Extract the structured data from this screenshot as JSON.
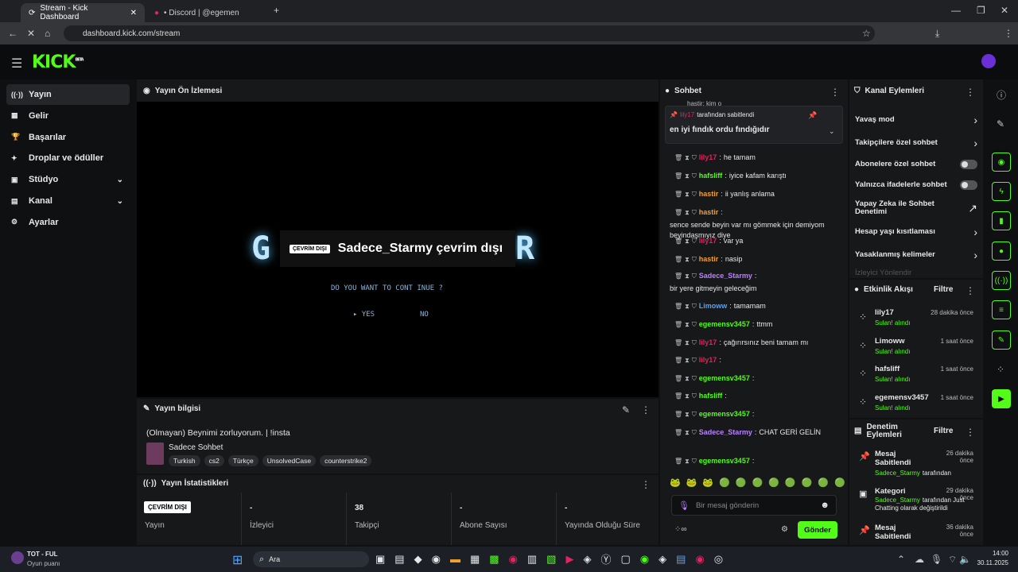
{
  "browser": {
    "tab1": "Stream - Kick Dashboard",
    "tab2": "• Discord | @egemen",
    "url": "dashboard.kick.com/stream"
  },
  "logo": {
    "text": "KICK",
    "beta": "BETA"
  },
  "sidebar": {
    "items": [
      {
        "label": "Yayın",
        "icon": "broadcast-icon"
      },
      {
        "label": "Gelir",
        "icon": "money-icon"
      },
      {
        "label": "Başarılar",
        "icon": "trophy-icon"
      },
      {
        "label": "Droplar ve ödüller",
        "icon": "gift-icon"
      },
      {
        "label": "Stüdyo",
        "icon": "studio-icon"
      },
      {
        "label": "Kanal",
        "icon": "channel-icon"
      },
      {
        "label": "Ayarlar",
        "icon": "gear-icon"
      }
    ]
  },
  "preview": {
    "title": "Yayın Ön İzlemesi",
    "badge": "ÇEVRİM DIŞI",
    "offline": "Sadece_Starmy çevrim dışı",
    "question": "DO YOU WANT TO CONT INUE ?",
    "yes": "▸ YES",
    "no": "NO",
    "left_letter": "G",
    "right_letter": "R"
  },
  "info": {
    "title": "Yayın bilgisi",
    "stream_title": "(Olmayan) Beynimi zorluyorum. | !insta",
    "category": "Sadece Sohbet",
    "tags": [
      "Turkish",
      "cs2",
      "Türkçe",
      "UnsolvedCase",
      "counterstrike2"
    ]
  },
  "stats": {
    "title": "Yayın İstatistikleri",
    "status_badge": "ÇEVRİM DIŞI",
    "cols": [
      {
        "value": "",
        "label": "Yayın"
      },
      {
        "value": "-",
        "label": "İzleyici"
      },
      {
        "value": "38",
        "label": "Takipçi"
      },
      {
        "value": "-",
        "label": "Abone Sayısı"
      },
      {
        "value": "-",
        "label": "Yayında Olduğu Süre"
      }
    ]
  },
  "chat": {
    "title": "Sohbet",
    "partial_top": "hastir: kim o",
    "pinned_by": "lily17",
    "pinned_suffix": "tarafından sabitlendi",
    "pinned_msg": "en iyi fındık ordu fındığıdır",
    "messages": [
      {
        "user": "lily17",
        "text": "he tamam",
        "color": "#e0245e"
      },
      {
        "user": "hafsliff",
        "text": "iyice kafam karıştı",
        "color": "#53fc18"
      },
      {
        "user": "hastir",
        "text": "ii yanlış anlama",
        "color": "#f0a030"
      },
      {
        "user": "hastir",
        "text": "sence sende beyin var mı gömmek için demiyom beyindaşmıyız diye",
        "color": "#f0a030"
      },
      {
        "user": "lily17",
        "text": "var ya",
        "color": "#e0245e"
      },
      {
        "user": "hastir",
        "text": "nasip",
        "color": "#f0a030"
      },
      {
        "user": "Sadece_Starmy",
        "text": "bir yere gitmeyin geleceğim",
        "color": "#b982ff"
      },
      {
        "user": "Limoww",
        "text": "tamamam",
        "color": "#4fa3ff"
      },
      {
        "user": "egemensv3457",
        "text": "ttmm",
        "color": "#53fc18"
      },
      {
        "user": "lily17",
        "text": "çağırırsınız beni tamam mı",
        "color": "#e0245e"
      },
      {
        "user": "lily17",
        "text": "",
        "color": "#e0245e"
      },
      {
        "user": "egemensv3457",
        "text": "",
        "color": "#53fc18"
      },
      {
        "user": "hafsliff",
        "text": "",
        "color": "#53fc18"
      },
      {
        "user": "egemensv3457",
        "text": "",
        "color": "#53fc18"
      },
      {
        "user": "Sadece_Starmy",
        "text": "CHAT GERİ GELİN",
        "color": "#b982ff"
      },
      {
        "user": "egemensv3457",
        "text": "",
        "color": "#53fc18"
      }
    ],
    "placeholder": "Bir mesaj gönderin",
    "send": "Gönder"
  },
  "actions": {
    "title": "Kanal Eylemleri",
    "items": [
      {
        "label": "Yavaş mod",
        "kind": "arrow"
      },
      {
        "label": "Takipçilere özel sohbet",
        "kind": "arrow"
      },
      {
        "label": "Abonelere özel sohbet",
        "kind": "toggle"
      },
      {
        "label": "Yalnızca ifadelerle sohbet",
        "kind": "toggle"
      },
      {
        "label": "Yapay Zeka ile Sohbet Denetimi",
        "kind": "ext"
      },
      {
        "label": "Hesap yaşı kısıtlaması",
        "kind": "arrow"
      },
      {
        "label": "Yasaklanmış kelimeler",
        "kind": "arrow"
      }
    ],
    "faded": "İzleyici Yönlendir"
  },
  "activity": {
    "title": "Etkinlik Akışı",
    "filter": "Filtre",
    "items": [
      {
        "user": "lily17",
        "action": "Sulan! alındı",
        "time": "28 dakika önce"
      },
      {
        "user": "Limoww",
        "action": "Sulan! alındı",
        "time": "1 saat önce"
      },
      {
        "user": "hafsliff",
        "action": "Sulan! alındı",
        "time": "1 saat önce"
      },
      {
        "user": "egemensv3457",
        "action": "Sulan! alındı",
        "time": "1 saat önce"
      }
    ]
  },
  "moderation": {
    "title": "Denetim Eylemleri",
    "filter": "Filtre",
    "items": [
      {
        "title": "Mesaj Sabitlendi",
        "by": "Sadece_Starmy",
        "rest": "tarafından",
        "time": "26 dakika önce"
      },
      {
        "title": "Kategori",
        "by": "Sadece_Starmy",
        "rest": "tarafından Just Chatting olarak değiştirildi",
        "time": "29 dakika önce"
      },
      {
        "title": "Mesaj Sabitlendi",
        "by": "",
        "rest": "",
        "time": "36 dakika önce"
      }
    ]
  },
  "taskbar": {
    "game": "TOT - FUL",
    "game_sub": "Oyun puanı",
    "search": "Ara",
    "time": "14:00",
    "date": "30.11.2025"
  }
}
